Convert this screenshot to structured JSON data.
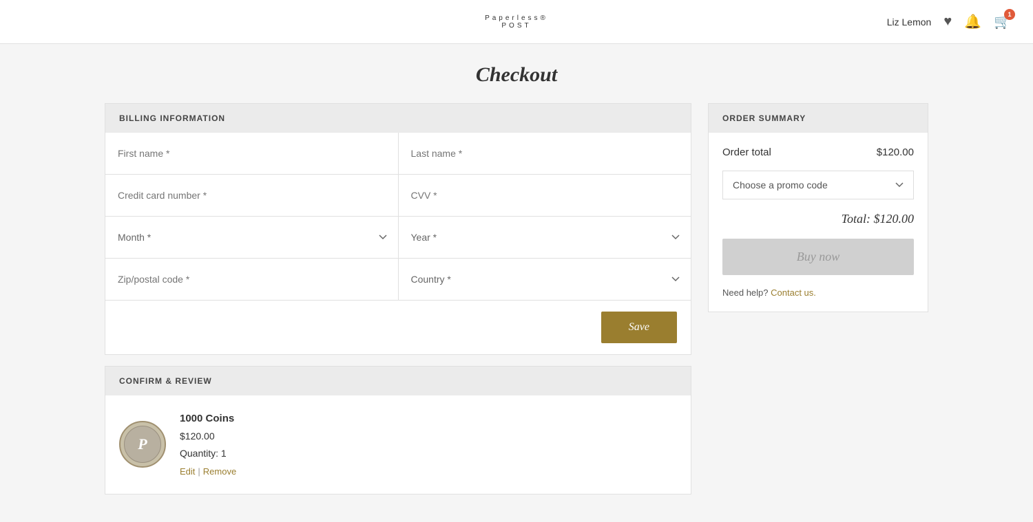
{
  "header": {
    "logo_line1": "Paperless®",
    "logo_line2": "POST",
    "username": "Liz Lemon",
    "cart_count": "1"
  },
  "page": {
    "title": "Checkout"
  },
  "billing": {
    "section_title": "BILLING INFORMATION",
    "first_name_placeholder": "First name *",
    "last_name_placeholder": "Last name *",
    "credit_card_placeholder": "Credit card number *",
    "cvv_placeholder": "CVV *",
    "month_placeholder": "Month *",
    "year_placeholder": "Year *",
    "zip_placeholder": "Zip/postal code *",
    "country_placeholder": "Country *",
    "save_label": "Save"
  },
  "order_summary": {
    "section_title": "ORDER SUMMARY",
    "order_total_label": "Order total",
    "order_total_value": "$120.00",
    "promo_placeholder": "Choose a promo code",
    "total_label": "Total: $120.00",
    "buy_now_label": "Buy now",
    "help_text": "Need help?",
    "contact_text": "Contact us."
  },
  "confirm_review": {
    "section_title": "CONFIRM & REVIEW",
    "product_name": "1000 Coins",
    "product_price": "$120.00",
    "product_quantity": "Quantity: 1",
    "edit_label": "Edit",
    "remove_label": "Remove",
    "product_logo_letter": "P"
  }
}
